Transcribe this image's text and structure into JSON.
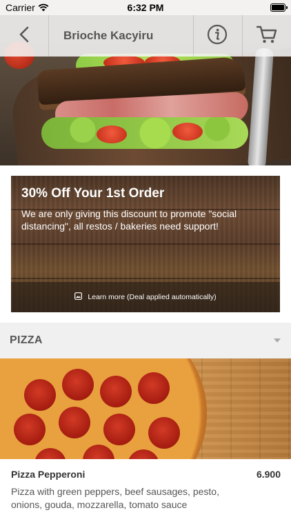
{
  "status_bar": {
    "carrier": "Carrier",
    "time": "6:32 PM"
  },
  "nav": {
    "title": "Brioche Kacyiru",
    "back_icon": "chevron-left-icon",
    "info_icon": "info-icon",
    "cart_icon": "cart-icon"
  },
  "promo": {
    "title": "30% Off Your 1st Order",
    "text": "We are only giving this discount to promote \"social distancing\", all restos / bakeries need support!",
    "learn_more": "Learn more (Deal applied automatically)"
  },
  "category": {
    "title": "PIZZA"
  },
  "items": [
    {
      "name": "Pizza Pepperoni",
      "price": "6.900",
      "description": "Pizza with green peppers, beef sausages, pesto, onions, gouda, mozzarella, tomato sauce"
    }
  ],
  "colors": {
    "nav_background": "#f5f5f5",
    "icon_gray": "#555555",
    "category_background": "#f0f0f0"
  }
}
